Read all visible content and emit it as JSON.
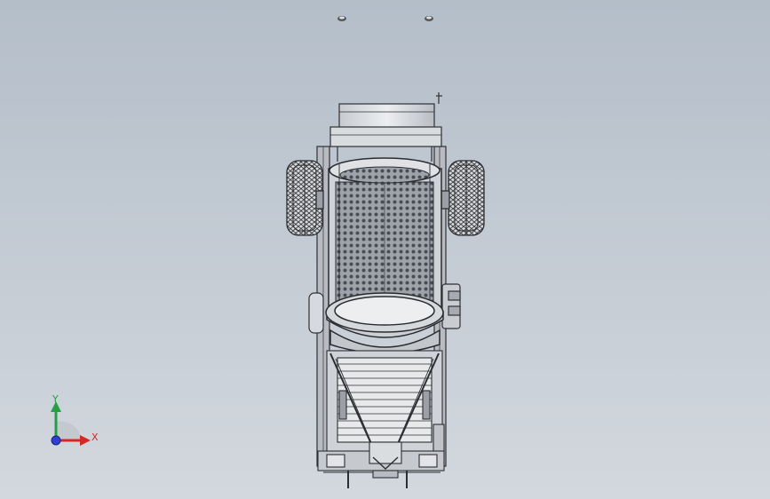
{
  "viewport": {
    "background_top": "#b4bec9",
    "background_bottom": "#d3d8de",
    "model": "drum-screen-machine-top-view"
  },
  "triad": {
    "y_label": "Y",
    "x_label": "X",
    "colors": {
      "x": "#d62626",
      "y": "#23a043",
      "z": "#2d3fd6"
    }
  }
}
